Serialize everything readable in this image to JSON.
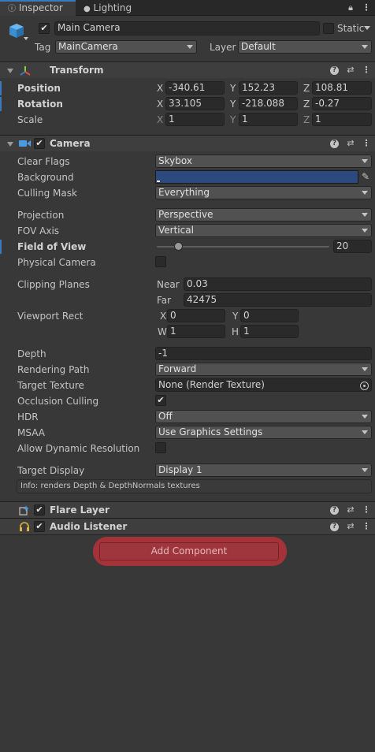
{
  "tabs": [
    {
      "label": "Inspector",
      "active": true
    },
    {
      "label": "Lighting",
      "active": false
    }
  ],
  "header": {
    "object_name": "Main Camera",
    "static_label": "Static",
    "tag_label": "Tag",
    "tag_value": "MainCamera",
    "layer_label": "Layer",
    "layer_value": "Default"
  },
  "transform": {
    "title": "Transform",
    "position": {
      "label": "Position",
      "x": "-340.61",
      "y": "152.23",
      "z": "108.81"
    },
    "rotation": {
      "label": "Rotation",
      "x": "33.105",
      "y": "-218.088",
      "z": "-0.27"
    },
    "scale": {
      "label": "Scale",
      "x": "1",
      "y": "1",
      "z": "1"
    },
    "axes": {
      "x": "X",
      "y": "Y",
      "z": "Z",
      "w": "W",
      "h": "H"
    }
  },
  "camera": {
    "title": "Camera",
    "clear_flags": {
      "label": "Clear Flags",
      "value": "Skybox"
    },
    "background": {
      "label": "Background",
      "color": "#2d4a7f"
    },
    "culling_mask": {
      "label": "Culling Mask",
      "value": "Everything"
    },
    "projection": {
      "label": "Projection",
      "value": "Perspective"
    },
    "fov_axis": {
      "label": "FOV Axis",
      "value": "Vertical"
    },
    "field_of_view": {
      "label": "Field of View",
      "value": "20",
      "fraction": 0.13
    },
    "physical_camera": {
      "label": "Physical Camera",
      "checked": false
    },
    "clipping": {
      "label": "Clipping Planes",
      "near_label": "Near",
      "near": "0.03",
      "far_label": "Far",
      "far": "42475"
    },
    "viewport": {
      "label": "Viewport Rect",
      "x": "0",
      "y": "0",
      "w": "1",
      "h": "1"
    },
    "depth": {
      "label": "Depth",
      "value": "-1"
    },
    "rendering_path": {
      "label": "Rendering Path",
      "value": "Forward"
    },
    "target_texture": {
      "label": "Target Texture",
      "value": "None (Render Texture)"
    },
    "occlusion_culling": {
      "label": "Occlusion Culling",
      "checked": true
    },
    "hdr": {
      "label": "HDR",
      "value": "Off"
    },
    "msaa": {
      "label": "MSAA",
      "value": "Use Graphics Settings"
    },
    "dynamic_resolution": {
      "label": "Allow Dynamic Resolution",
      "checked": false
    },
    "target_display": {
      "label": "Target Display",
      "value": "Display 1"
    },
    "info": "Info: renders Depth & DepthNormals textures"
  },
  "components": {
    "flare_layer": "Flare Layer",
    "audio_listener": "Audio Listener"
  },
  "add_component_label": "Add Component",
  "colors": {
    "accent": "#3a79bb",
    "highlight": "#c8323a"
  }
}
